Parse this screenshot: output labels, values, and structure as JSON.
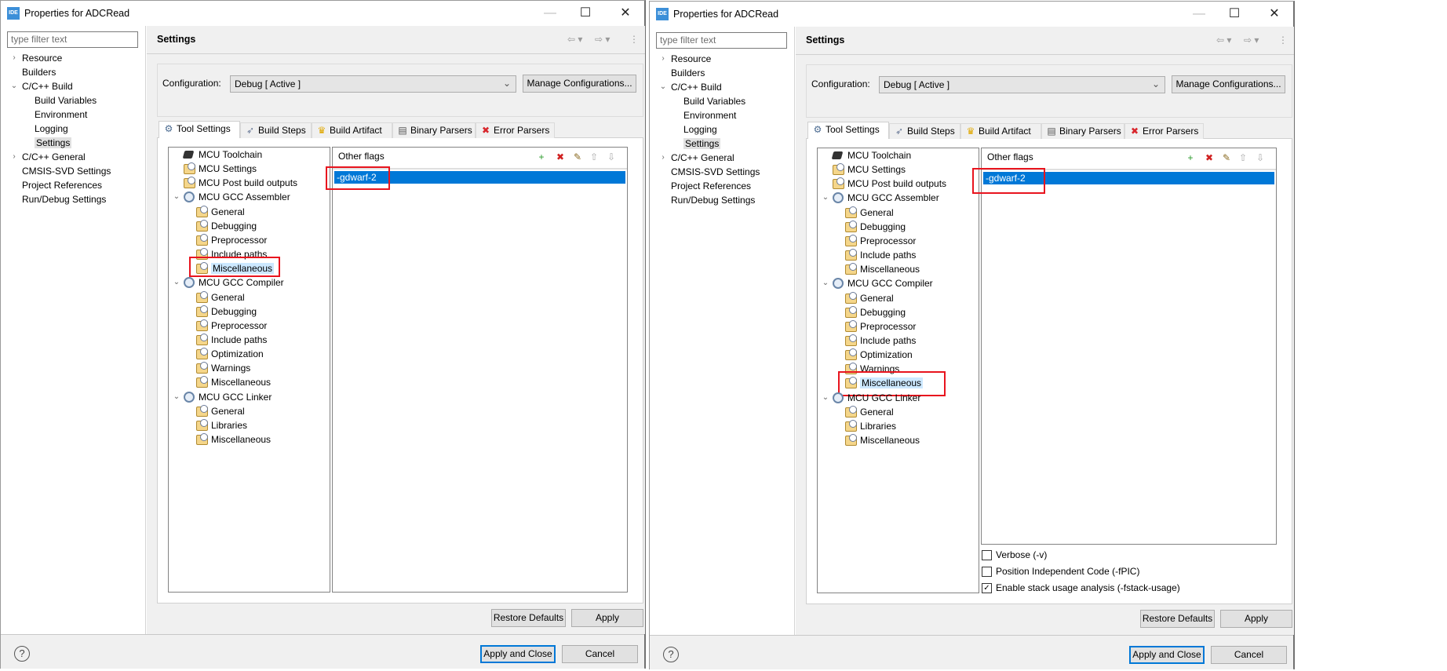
{
  "colors": {
    "selection": "#0078d7",
    "highlight_box": "#e8141e",
    "tree_selection": "#cce8ff"
  },
  "dialogs": [
    {
      "title": "Properties for ADCRead",
      "app_icon_text": "IDE",
      "filter_placeholder": "type filter text",
      "nav": [
        {
          "label": "Resource",
          "level": 0,
          "expander": "collapsed"
        },
        {
          "label": "Builders",
          "level": 0
        },
        {
          "label": "C/C++ Build",
          "level": 0,
          "expander": "expanded"
        },
        {
          "label": "Build Variables",
          "level": 1
        },
        {
          "label": "Environment",
          "level": 1
        },
        {
          "label": "Logging",
          "level": 1
        },
        {
          "label": "Settings",
          "level": 1,
          "selected": true
        },
        {
          "label": "C/C++ General",
          "level": 0,
          "expander": "collapsed"
        },
        {
          "label": "CMSIS-SVD Settings",
          "level": 0
        },
        {
          "label": "Project References",
          "level": 0
        },
        {
          "label": "Run/Debug Settings",
          "level": 0
        }
      ],
      "header": "Settings",
      "config_label": "Configuration:",
      "config_value": "Debug  [ Active ]",
      "manage_label": "Manage Configurations...",
      "tabs": [
        {
          "label": "Tool Settings",
          "icon": "tool-settings-icon",
          "active": true
        },
        {
          "label": "Build Steps",
          "icon": "build-steps-icon"
        },
        {
          "label": "Build Artifact",
          "icon": "build-artifact-icon"
        },
        {
          "label": "Binary Parsers",
          "icon": "binary-parsers-icon"
        },
        {
          "label": "Error Parsers",
          "icon": "error-parsers-icon"
        }
      ],
      "tool_tree": [
        {
          "label": "MCU Toolchain",
          "level": 0,
          "icon": "chip"
        },
        {
          "label": "MCU Settings",
          "level": 0,
          "icon": "folder"
        },
        {
          "label": "MCU Post build outputs",
          "level": 0,
          "icon": "folder"
        },
        {
          "label": "MCU GCC Assembler",
          "level": 0,
          "icon": "gear",
          "expander": "expanded"
        },
        {
          "label": "General",
          "level": 1,
          "icon": "folder"
        },
        {
          "label": "Debugging",
          "level": 1,
          "icon": "folder"
        },
        {
          "label": "Preprocessor",
          "level": 1,
          "icon": "folder"
        },
        {
          "label": "Include paths",
          "level": 1,
          "icon": "folder"
        },
        {
          "label": "Miscellaneous",
          "level": 1,
          "icon": "folder",
          "selected": true
        },
        {
          "label": "MCU GCC Compiler",
          "level": 0,
          "icon": "gear",
          "expander": "expanded"
        },
        {
          "label": "General",
          "level": 1,
          "icon": "folder"
        },
        {
          "label": "Debugging",
          "level": 1,
          "icon": "folder"
        },
        {
          "label": "Preprocessor",
          "level": 1,
          "icon": "folder"
        },
        {
          "label": "Include paths",
          "level": 1,
          "icon": "folder"
        },
        {
          "label": "Optimization",
          "level": 1,
          "icon": "folder"
        },
        {
          "label": "Warnings",
          "level": 1,
          "icon": "folder"
        },
        {
          "label": "Miscellaneous",
          "level": 1,
          "icon": "folder"
        },
        {
          "label": "MCU GCC Linker",
          "level": 0,
          "icon": "gear",
          "expander": "expanded"
        },
        {
          "label": "General",
          "level": 1,
          "icon": "folder"
        },
        {
          "label": "Libraries",
          "level": 1,
          "icon": "folder"
        },
        {
          "label": "Miscellaneous",
          "level": 1,
          "icon": "folder"
        }
      ],
      "list_header": "Other flags",
      "flags": [
        "-gdwarf-2"
      ],
      "checkboxes": [],
      "restore_label": "Restore Defaults",
      "apply_label": "Apply",
      "apply_close_label": "Apply and Close",
      "cancel_label": "Cancel"
    },
    {
      "title": "Properties for ADCRead",
      "app_icon_text": "IDE",
      "filter_placeholder": "type filter text",
      "nav": [
        {
          "label": "Resource",
          "level": 0,
          "expander": "collapsed"
        },
        {
          "label": "Builders",
          "level": 0
        },
        {
          "label": "C/C++ Build",
          "level": 0,
          "expander": "expanded"
        },
        {
          "label": "Build Variables",
          "level": 1
        },
        {
          "label": "Environment",
          "level": 1
        },
        {
          "label": "Logging",
          "level": 1
        },
        {
          "label": "Settings",
          "level": 1,
          "selected": true
        },
        {
          "label": "C/C++ General",
          "level": 0,
          "expander": "collapsed"
        },
        {
          "label": "CMSIS-SVD Settings",
          "level": 0
        },
        {
          "label": "Project References",
          "level": 0
        },
        {
          "label": "Run/Debug Settings",
          "level": 0
        }
      ],
      "header": "Settings",
      "config_label": "Configuration:",
      "config_value": "Debug  [ Active ]",
      "manage_label": "Manage Configurations...",
      "tabs": [
        {
          "label": "Tool Settings",
          "icon": "tool-settings-icon",
          "active": true
        },
        {
          "label": "Build Steps",
          "icon": "build-steps-icon"
        },
        {
          "label": "Build Artifact",
          "icon": "build-artifact-icon"
        },
        {
          "label": "Binary Parsers",
          "icon": "binary-parsers-icon"
        },
        {
          "label": "Error Parsers",
          "icon": "error-parsers-icon"
        }
      ],
      "tool_tree": [
        {
          "label": "MCU Toolchain",
          "level": 0,
          "icon": "chip"
        },
        {
          "label": "MCU Settings",
          "level": 0,
          "icon": "folder"
        },
        {
          "label": "MCU Post build outputs",
          "level": 0,
          "icon": "folder"
        },
        {
          "label": "MCU GCC Assembler",
          "level": 0,
          "icon": "gear",
          "expander": "expanded"
        },
        {
          "label": "General",
          "level": 1,
          "icon": "folder"
        },
        {
          "label": "Debugging",
          "level": 1,
          "icon": "folder"
        },
        {
          "label": "Preprocessor",
          "level": 1,
          "icon": "folder"
        },
        {
          "label": "Include paths",
          "level": 1,
          "icon": "folder"
        },
        {
          "label": "Miscellaneous",
          "level": 1,
          "icon": "folder"
        },
        {
          "label": "MCU GCC Compiler",
          "level": 0,
          "icon": "gear",
          "expander": "expanded"
        },
        {
          "label": "General",
          "level": 1,
          "icon": "folder"
        },
        {
          "label": "Debugging",
          "level": 1,
          "icon": "folder"
        },
        {
          "label": "Preprocessor",
          "level": 1,
          "icon": "folder"
        },
        {
          "label": "Include paths",
          "level": 1,
          "icon": "folder"
        },
        {
          "label": "Optimization",
          "level": 1,
          "icon": "folder"
        },
        {
          "label": "Warnings",
          "level": 1,
          "icon": "folder"
        },
        {
          "label": "Miscellaneous",
          "level": 1,
          "icon": "folder",
          "selected": true
        },
        {
          "label": "MCU GCC Linker",
          "level": 0,
          "icon": "gear",
          "expander": "expanded"
        },
        {
          "label": "General",
          "level": 1,
          "icon": "folder"
        },
        {
          "label": "Libraries",
          "level": 1,
          "icon": "folder"
        },
        {
          "label": "Miscellaneous",
          "level": 1,
          "icon": "folder"
        }
      ],
      "list_header": "Other flags",
      "flags": [
        "-gdwarf-2"
      ],
      "checkboxes": [
        {
          "label": "Verbose (-v)",
          "checked": false
        },
        {
          "label": "Position Independent Code (-fPIC)",
          "checked": false
        },
        {
          "label": "Enable stack usage analysis (-fstack-usage)",
          "checked": true
        }
      ],
      "restore_label": "Restore Defaults",
      "apply_label": "Apply",
      "apply_close_label": "Apply and Close",
      "cancel_label": "Cancel"
    }
  ]
}
